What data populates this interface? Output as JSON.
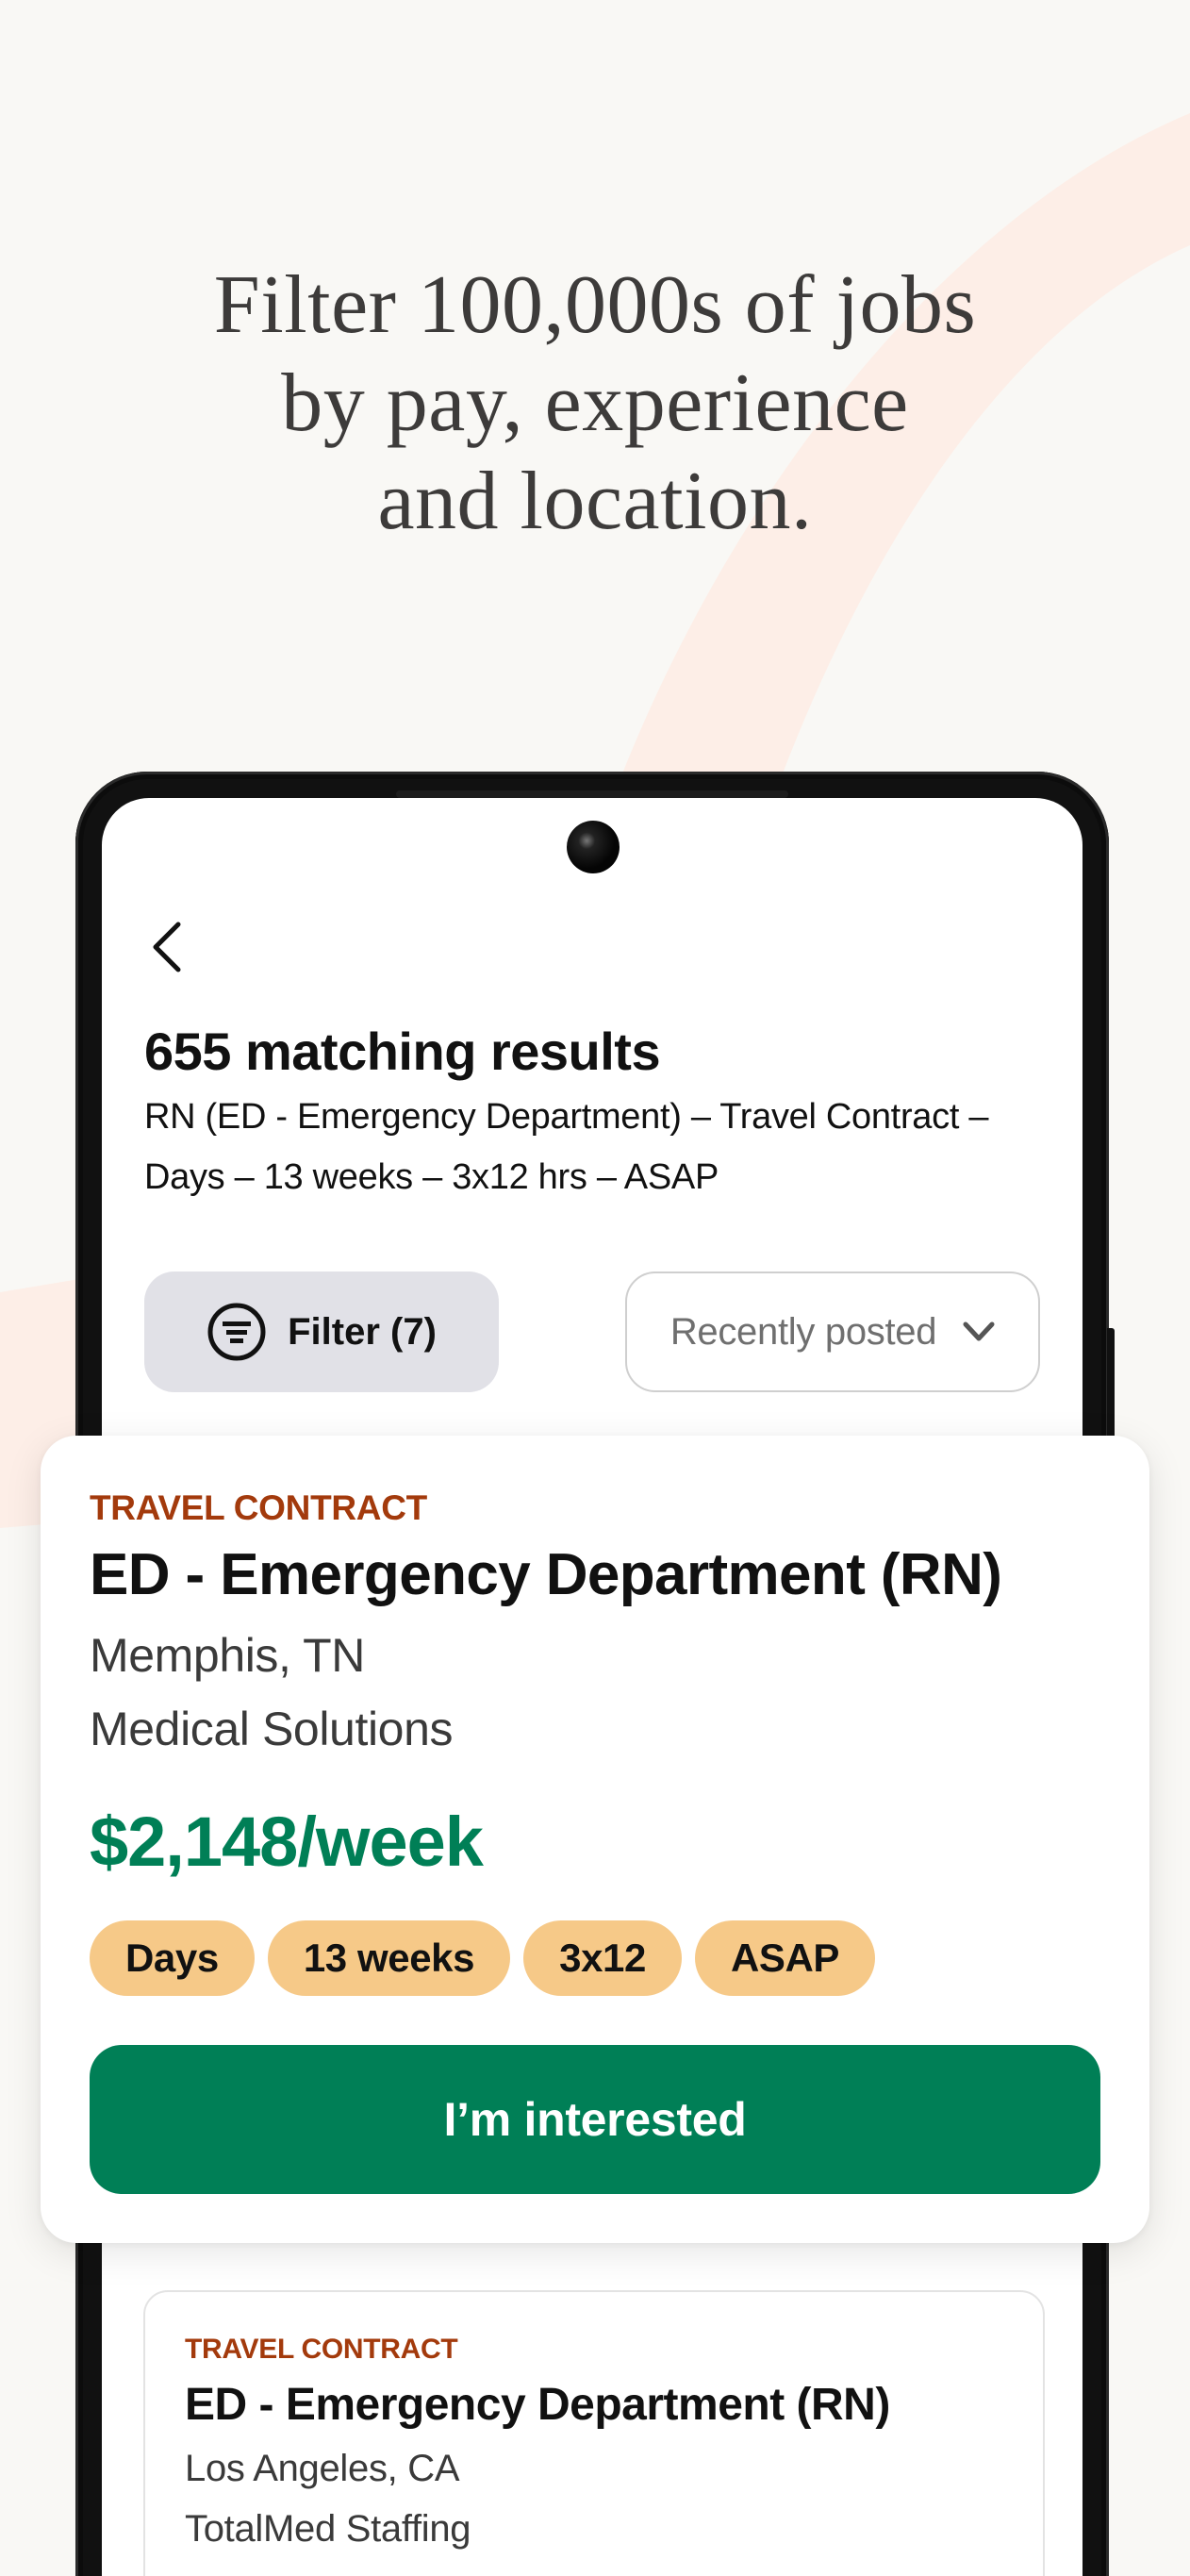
{
  "headline": {
    "lines": [
      "Filter 100,000s of jobs",
      "by pay, experience",
      "and location."
    ]
  },
  "results": {
    "title": "655 matching results",
    "subtitle": "RN (ED - Emergency Department) – Travel Contract – Days – 13 weeks – 3x12 hrs – ASAP"
  },
  "controls": {
    "filter_label": "Filter (7)",
    "filter_icon": "filter-circle-icon",
    "sort_selected": "Recently posted",
    "sort_icon": "chevron-down-icon",
    "back_icon": "chevron-left-icon"
  },
  "featured_job": {
    "type": "TRAVEL CONTRACT",
    "title": "ED - Emergency Department (RN)",
    "location": "Memphis, TN",
    "company": "Medical Solutions",
    "pay": "$2,148/week",
    "tags": [
      "Days",
      "13 weeks",
      "3x12",
      "ASAP"
    ],
    "cta_label": "I’m interested"
  },
  "next_job": {
    "type": "TRAVEL CONTRACT",
    "title": "ED - Emergency Department (RN)",
    "location": "Los Angeles, CA",
    "company": "TotalMed Staffing"
  },
  "colors": {
    "background": "#f9f8f5",
    "accent_green": "#007f56",
    "job_type_orange": "#a33a0c",
    "tag_bg": "#f6c988",
    "filter_bg": "#e1e1e7",
    "swoosh": "#fdeee7"
  }
}
